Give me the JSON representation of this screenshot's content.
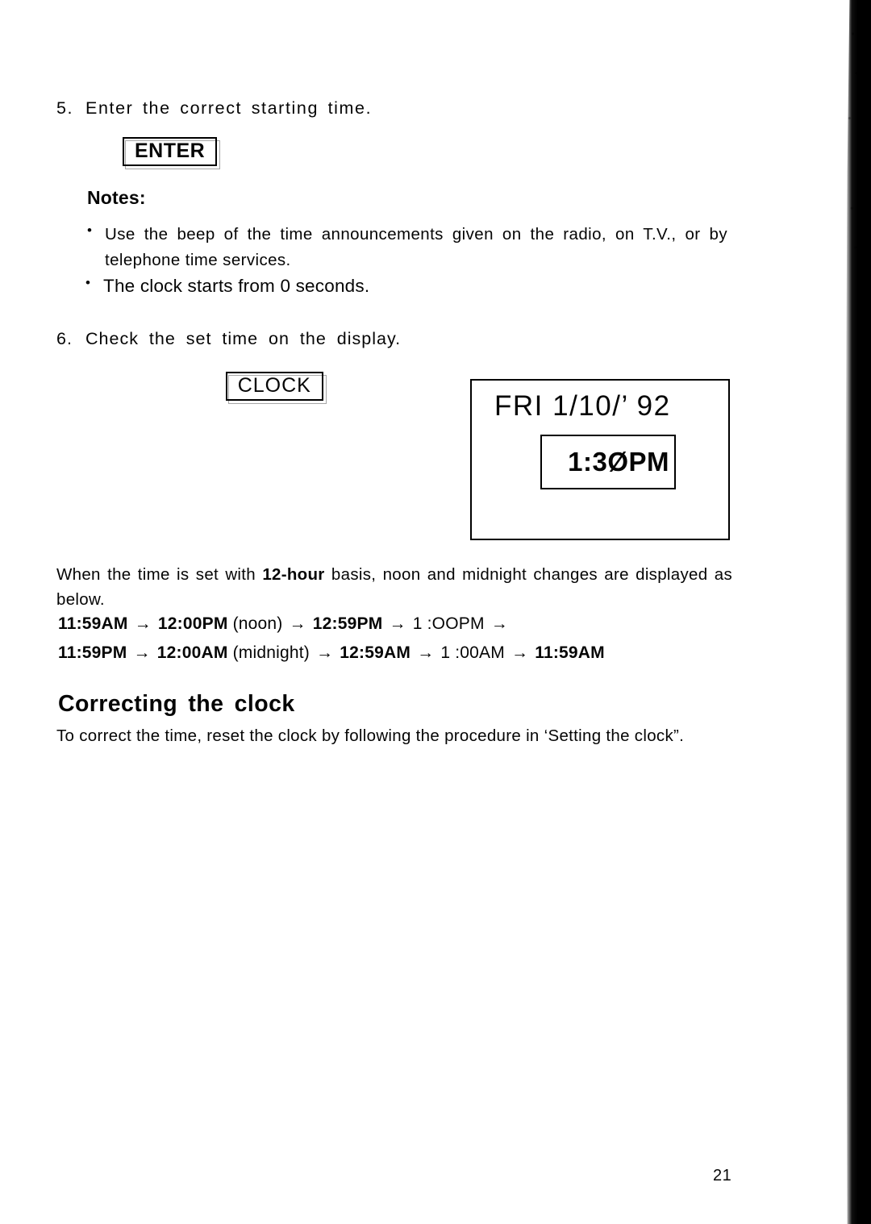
{
  "page": {
    "number": "21"
  },
  "steps": [
    {
      "number": "5.",
      "text": "Enter the correct starting time.",
      "key": "ENTER"
    },
    {
      "number": "6.",
      "text": "Check the set time on the display.",
      "key": "CLOCK"
    }
  ],
  "notes": {
    "title": "Notes:",
    "bullet_glyph": "•",
    "items": [
      "Use the beep of the time announcements given on the radio, on T.V., or by telephone time services.",
      "The clock starts from 0 seconds."
    ]
  },
  "display": {
    "date_line": "FRI 1/10/’ 92",
    "time": "1:3ØPM"
  },
  "twelve_hour": {
    "intro_before": "When the time is set with ",
    "intro_bold": "12-hour",
    "intro_after": " basis, noon and midnight changes are displayed as below.",
    "arrow": "→",
    "sequences": [
      {
        "parts": [
          {
            "text": "11:59AM",
            "style": "t"
          },
          {
            "text": "→",
            "style": "arw"
          },
          {
            "text": "12:00PM",
            "style": "t"
          },
          {
            "text": "(noon)",
            "style": "lbl"
          },
          {
            "text": "→",
            "style": "arw"
          },
          {
            "text": "12:59PM",
            "style": "t"
          },
          {
            "text": "→",
            "style": "arw"
          },
          {
            "text": "1 :OOPM",
            "style": "lbl"
          },
          {
            "text": "→",
            "style": "arw"
          }
        ]
      },
      {
        "parts": [
          {
            "text": "11:59PM",
            "style": "t"
          },
          {
            "text": "→",
            "style": "arw"
          },
          {
            "text": "12:00AM",
            "style": "t"
          },
          {
            "text": "(midnight)",
            "style": "lbl"
          },
          {
            "text": "→",
            "style": "arw"
          },
          {
            "text": "12:59AM",
            "style": "t"
          },
          {
            "text": "→",
            "style": "arw"
          },
          {
            "text": "1 :00AM",
            "style": "lbl"
          },
          {
            "text": "→",
            "style": "arw"
          },
          {
            "text": "11:59AM",
            "style": "t"
          }
        ]
      }
    ]
  },
  "correcting": {
    "heading": "Correcting the clock",
    "body": "To correct the time, reset the clock by following the procedure in ‘Setting the clock”."
  }
}
